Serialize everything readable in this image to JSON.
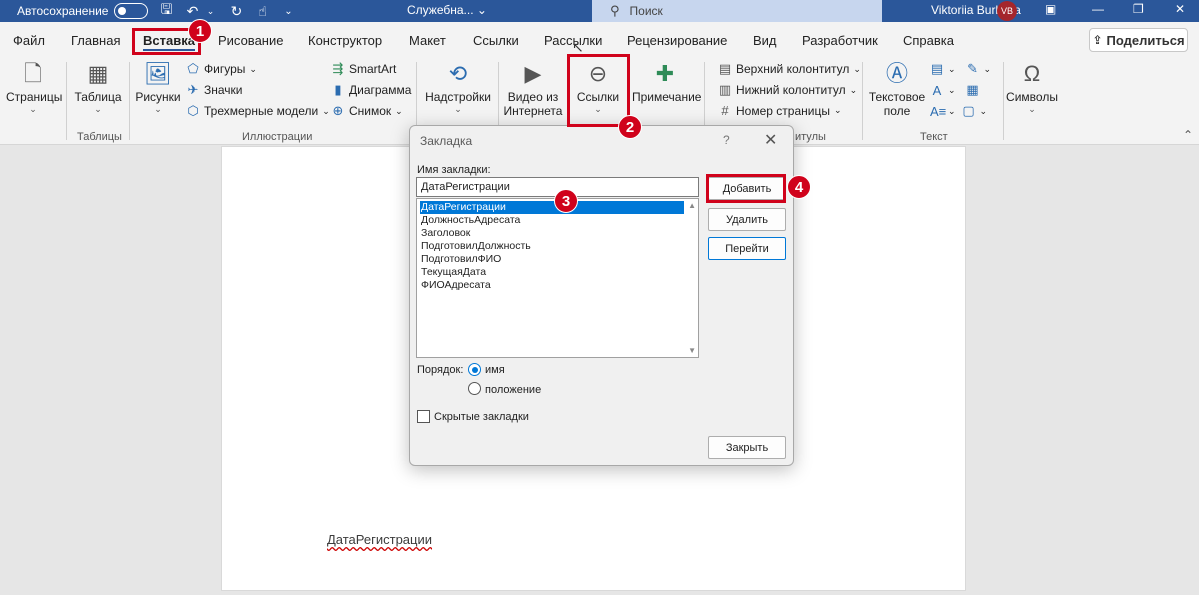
{
  "titlebar": {
    "autosave_label": "Автосохранение",
    "doc_name": "Служебна... ⌄",
    "search_placeholder": "Поиск",
    "user_name": "Viktoriia Burkova",
    "user_initials": "VB"
  },
  "menu": {
    "tabs": [
      "Файл",
      "Главная",
      "Вставка",
      "Рисование",
      "Конструктор",
      "Макет",
      "Ссылки",
      "Рассылки",
      "Рецензирование",
      "Вид",
      "Разработчик",
      "Справка"
    ],
    "active_tab": "Вставка",
    "share_label": "Поделиться"
  },
  "ribbon": {
    "pages": "Страницы",
    "table": "Таблица",
    "pictures": "Рисунки",
    "shapes": "Фигуры",
    "icons": "Значки",
    "models3d": "Трехмерные модели",
    "smartart": "SmartArt",
    "chart": "Диаграмма",
    "screenshot": "Снимок",
    "addins": "Надстройки",
    "online_video_line1": "Видео из",
    "online_video_line2": "Интернета",
    "links": "Ссылки",
    "comment": "Примечание",
    "header": "Верхний колонтитул",
    "footer": "Нижний колонтитул",
    "page_number": "Номер страницы",
    "textbox_line1": "Текстовое",
    "textbox_line2": "поле",
    "symbols": "Символы",
    "group_tables": "Таблицы",
    "group_illustrations": "Иллюстрации",
    "group_headers_fragment": "итулы",
    "group_text": "Текст"
  },
  "dialog": {
    "title": "Закладка",
    "help": "?",
    "name_label": "Имя закладки:",
    "name_value": "ДатаРегистрации",
    "bookmarks": [
      "ДатаРегистрации",
      "ДолжностьАдресата",
      "Заголовок",
      "ПодготовилДолжность",
      "ПодготовилФИО",
      "ТекущаяДата",
      "ФИОАдресата"
    ],
    "selected_bookmark": "ДатаРегистрации",
    "add_button": "Добавить",
    "delete_button": "Удалить",
    "goto_button": "Перейти",
    "order_label": "Порядок:",
    "order_name": "имя",
    "order_position": "положение",
    "order_selected": "имя",
    "hidden_label": "Скрытые закладки",
    "hidden_checked": false,
    "close_button": "Закрыть"
  },
  "document": {
    "text": "ДатаРегистрации"
  },
  "annotations": {
    "badges": [
      "1",
      "2",
      "3",
      "4"
    ],
    "color": "#d0021b"
  },
  "colors": {
    "accent": "#2b579a",
    "selection": "#0078d7"
  }
}
